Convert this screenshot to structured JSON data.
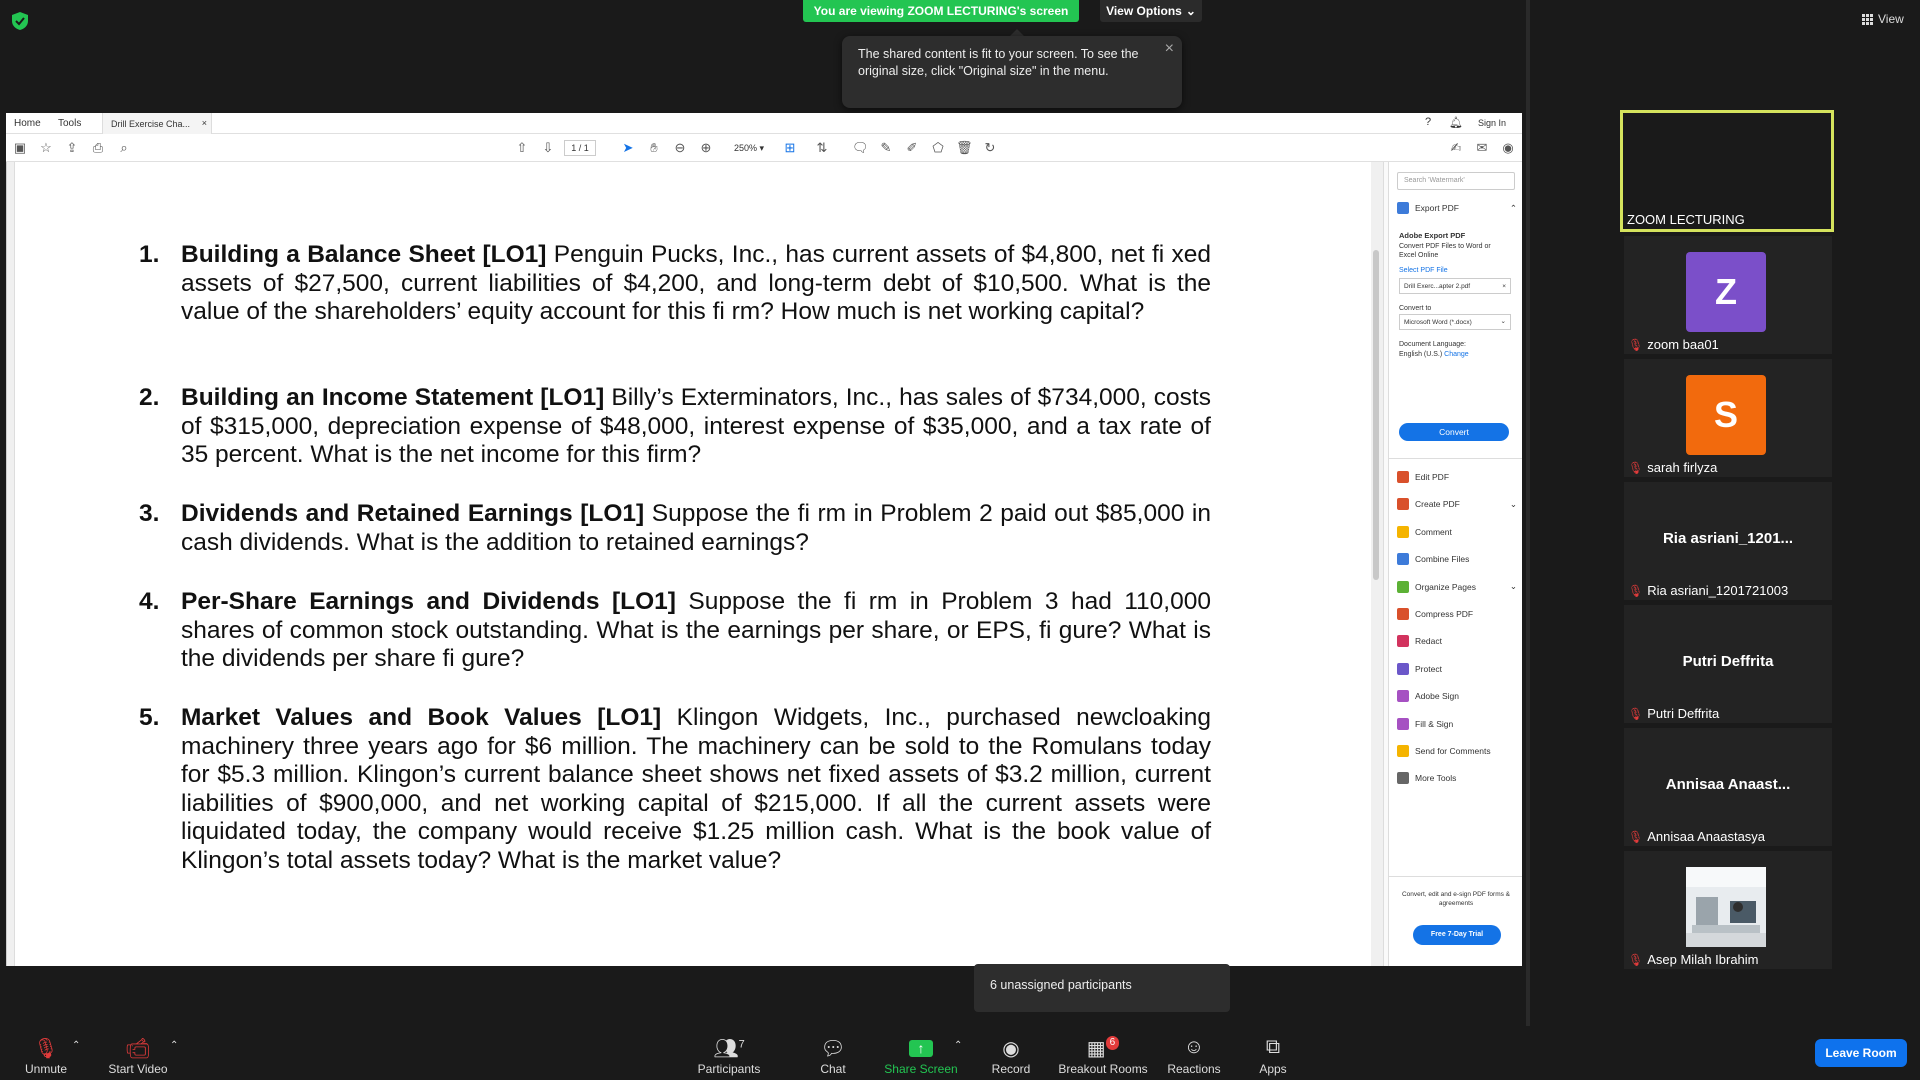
{
  "top": {
    "banner": "You are viewing ZOOM LECTURING's screen",
    "view_options": "View Options",
    "toast": "The shared content is fit to your screen. To see the original size, click \"Original size\" in the menu.",
    "view_label": "View"
  },
  "acrobat": {
    "menu": [
      "Home",
      "Tools"
    ],
    "doc_tab": "Drill Exercise Cha...",
    "sign_in": "Sign In",
    "page": "1",
    "page_total": "/ 1",
    "zoom": "250%",
    "pane": {
      "search_placeholder": "Search 'Watermark'",
      "export_pdf": "Export PDF",
      "adobe_export_title": "Adobe Export PDF",
      "adobe_export_desc": "Convert PDF Files to Word or Excel Online",
      "select_pdf": "Select PDF File",
      "file_name": "Drill Exerc...apter 2.pdf",
      "convert_to": "Convert to",
      "format": "Microsoft Word (*.docx)",
      "doc_language": "Document Language:",
      "language": "English (U.S.)",
      "change": "Change",
      "convert": "Convert",
      "tools": [
        "Edit PDF",
        "Create PDF",
        "Comment",
        "Combine Files",
        "Organize Pages",
        "Compress PDF",
        "Redact",
        "Protect",
        "Adobe Sign",
        "Fill & Sign",
        "Send for Comments",
        "More Tools"
      ],
      "tool_colors": [
        "#d9502b",
        "#d9502b",
        "#f5b400",
        "#3d7bd9",
        "#5cb135",
        "#d9502b",
        "#d2335e",
        "#6b57c9",
        "#a651c2",
        "#a651c2",
        "#f5b400",
        "#666666"
      ],
      "footer": "Convert, edit and e-sign PDF forms & agreements",
      "trial": "Free 7-Day Trial"
    }
  },
  "problems": [
    {
      "num": "1.",
      "title": "Building a Balance Sheet [LO1]",
      "text": " Penguin Pucks, Inc., has current assets of $4,800, net fi xed assets of $27,500, current liabilities of $4,200, and long-term debt of $10,500. What is the value of the shareholders’ equity account for this fi rm? How much is net working capital?"
    },
    {
      "num": "2.",
      "title": "Building an Income Statement [LO1]",
      "text": " Billy’s Exterminators, Inc., has sales of $734,000, costs of $315,000, depreciation expense of $48,000, interest expense of $35,000, and a tax rate of 35 percent. What is the net income for this firm?"
    },
    {
      "num": "3.",
      "title": "Dividends and Retained Earnings [LO1]",
      "text": " Suppose the fi rm in Problem 2 paid out $85,000 in cash dividends. What is the addition to retained earnings?"
    },
    {
      "num": "4.",
      "title": "Per-Share Earnings and Dividends [LO1]",
      "text": " Suppose the fi rm in Problem 3 had 110,000 shares of common stock outstanding. What is the earnings per share, or EPS, fi gure? What is the dividends per share fi gure?"
    },
    {
      "num": "5.",
      "title": "Market Values and Book Values [LO1]",
      "text": " Klingon Widgets, Inc., purchased newcloaking machinery three years ago for $6 million. The machinery can be sold to the Romulans today for $5.3 million. Klingon’s current balance sheet shows net fixed assets of $3.2 million, current liabilities of $900,000, and net working capital of $215,000. If all the current assets were liquidated today, the company would receive $1.25 million cash. What is the book value of Klingon’s total assets today? What is the market value?"
    }
  ],
  "participants": [
    {
      "name": "ZOOM LECTURING",
      "active": true
    },
    {
      "name": "zoom baa01",
      "initial": "Z",
      "color": "#7b4fc9"
    },
    {
      "name": "sarah firlyza",
      "initial": "S",
      "color": "#f26a0d"
    },
    {
      "name": "Ria asriani_1201721003",
      "display": "Ria  asriani_1201..."
    },
    {
      "name": "Putri Deffrita",
      "display": "Putri Deffrita"
    },
    {
      "name": "Annisaa Anaastasya",
      "display": "Annisaa  Anaast..."
    },
    {
      "name": "Asep Milah Ibrahim",
      "photo": true
    }
  ],
  "toolbar": {
    "unmute": "Unmute",
    "start_video": "Start Video",
    "participants": "Participants",
    "participants_count": "7",
    "chat": "Chat",
    "share_screen": "Share Screen",
    "record": "Record",
    "breakout_rooms": "Breakout Rooms",
    "breakout_badge": "6",
    "reactions": "Reactions",
    "apps": "Apps",
    "leave_room": "Leave Room",
    "unassigned_tooltip": "6 unassigned participants"
  },
  "colors": {
    "banner_green": "#23c552",
    "share_green": "#23c552",
    "leave_blue": "#0e72ed",
    "active_border": "#d5e35d",
    "mute_red": "#e23b3b"
  }
}
